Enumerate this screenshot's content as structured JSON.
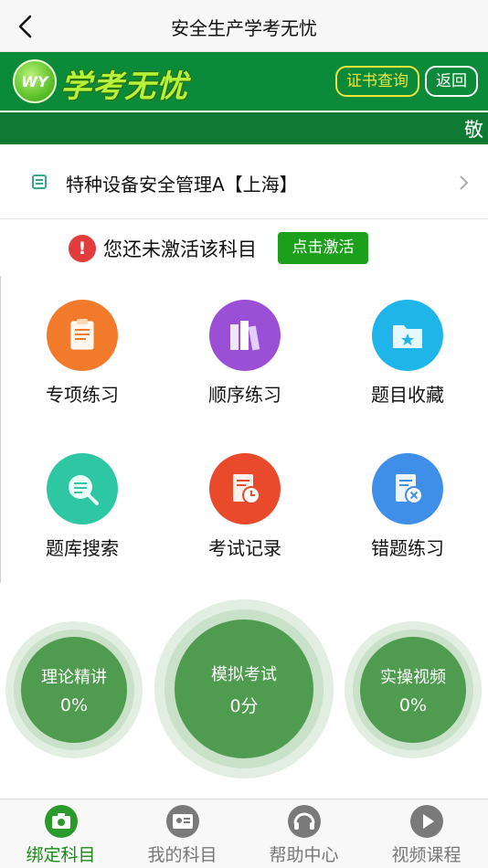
{
  "nav": {
    "title": "安全生产学考无忧"
  },
  "brand": {
    "logo_badge": "WY",
    "logo_text": "学考无忧",
    "cert_button": "证书查询",
    "back_button": "返回"
  },
  "marquee": {
    "text": "敬"
  },
  "subject": {
    "name": "特种设备安全管理A【上海】"
  },
  "activation": {
    "message": "您还未激活该科目",
    "button": "点击激活",
    "warn_mark": "!"
  },
  "features": [
    {
      "label": "专项练习",
      "icon": "clipboard-icon",
      "color": "#f27b2b"
    },
    {
      "label": "顺序练习",
      "icon": "books-icon",
      "color": "#9b4fd6"
    },
    {
      "label": "题目收藏",
      "icon": "star-folder-icon",
      "color": "#1fb5e8"
    },
    {
      "label": "题库搜索",
      "icon": "search-doc-icon",
      "color": "#2ec7a4"
    },
    {
      "label": "考试记录",
      "icon": "exam-clock-icon",
      "color": "#ea4a2c"
    },
    {
      "label": "错题练习",
      "icon": "wrong-doc-icon",
      "color": "#3f8ee8"
    }
  ],
  "progress": {
    "theory": {
      "label": "理论精讲",
      "value": "0%"
    },
    "mock": {
      "label": "模拟考试",
      "value": "0分"
    },
    "video": {
      "label": "实操视频",
      "value": "0%"
    }
  },
  "tabs": [
    {
      "label": "绑定科目",
      "icon": "camera-icon",
      "active": true
    },
    {
      "label": "我的科目",
      "icon": "id-card-icon",
      "active": false
    },
    {
      "label": "帮助中心",
      "icon": "headset-icon",
      "active": false
    },
    {
      "label": "视频课程",
      "icon": "play-icon",
      "active": false
    }
  ],
  "colors": {
    "brand_green": "#0b8a3a",
    "accent_green": "#1ca01c",
    "cert_yellow": "#f2e63a",
    "circle_green": "#4f9b4f"
  }
}
